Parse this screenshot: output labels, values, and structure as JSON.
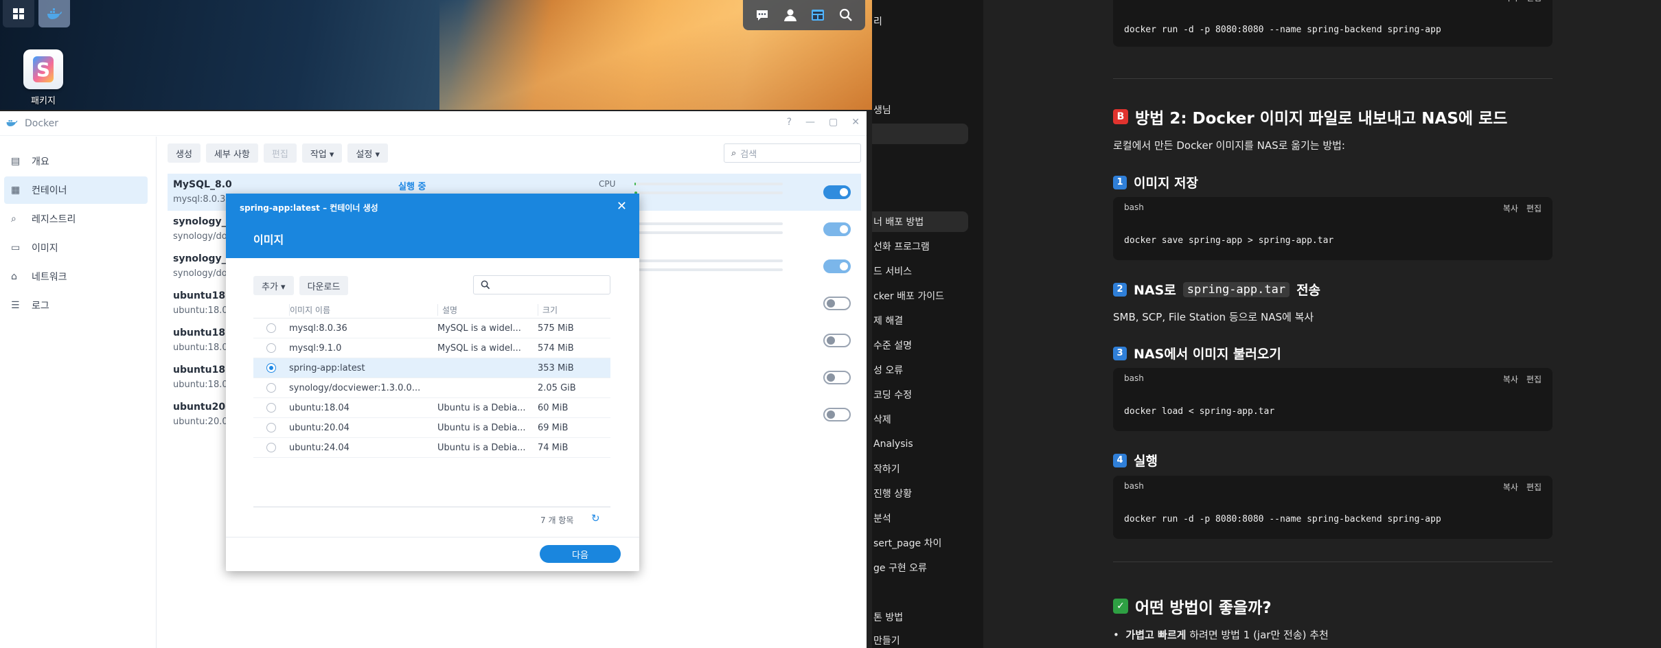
{
  "desktop": {
    "icon_label": "패키지"
  },
  "docker": {
    "title": "Docker",
    "sidebar": [
      {
        "label": "개요",
        "icon": "dashboard-icon"
      },
      {
        "label": "컨테이너",
        "icon": "container-icon"
      },
      {
        "label": "레지스트리",
        "icon": "registry-icon"
      },
      {
        "label": "이미지",
        "icon": "image-icon"
      },
      {
        "label": "네트워크",
        "icon": "network-icon"
      },
      {
        "label": "로그",
        "icon": "log-icon"
      }
    ],
    "toolbar": {
      "create": "생성",
      "details": "세부 사항",
      "edit": "편집",
      "action": "작업 ▾",
      "settings": "설정 ▾",
      "search_placeholder": "검색"
    },
    "containers": [
      {
        "name": "MySQL_8.0",
        "image": "mysql:8.0.3",
        "status": "실행 중",
        "cpu_label": "CPU",
        "cpu_usage": 0.02,
        "running": true
      },
      {
        "name": "synology_c",
        "image": "synology/doc",
        "running": true
      },
      {
        "name": "synology_",
        "image": "synology/doc",
        "running": true
      },
      {
        "name": "ubuntu18.",
        "image": "ubuntu:18.0",
        "running": false
      },
      {
        "name": "ubuntu18.",
        "image": "ubuntu:18.0",
        "running": false
      },
      {
        "name": "ubuntu18.",
        "image": "ubuntu:18.0",
        "running": false
      },
      {
        "name": "ubuntu20.",
        "image": "ubuntu:20.0",
        "running": false
      }
    ]
  },
  "modal": {
    "title": "spring-app:latest – 컨테이너 생성",
    "subtitle": "이미지",
    "add": "추가 ▾",
    "download": "다운로드",
    "columns": {
      "name": "이미지 이름",
      "desc": "설명",
      "size": "크기"
    },
    "rows": [
      {
        "name": "mysql:8.0.36",
        "desc": "MySQL is a widel...",
        "size": "575 MiB",
        "selected": false
      },
      {
        "name": "mysql:9.1.0",
        "desc": "MySQL is a widel...",
        "size": "574 MiB",
        "selected": false
      },
      {
        "name": "spring-app:latest",
        "desc": "",
        "size": "353 MiB",
        "selected": true
      },
      {
        "name": "synology/docviewer:1.3.0.0...",
        "desc": "",
        "size": "2.05 GiB",
        "selected": false
      },
      {
        "name": "ubuntu:18.04",
        "desc": "Ubuntu is a Debia...",
        "size": "60 MiB",
        "selected": false
      },
      {
        "name": "ubuntu:20.04",
        "desc": "Ubuntu is a Debia...",
        "size": "69 MiB",
        "selected": false
      },
      {
        "name": "ubuntu:24.04",
        "desc": "Ubuntu is a Debia...",
        "size": "74 MiB",
        "selected": false
      }
    ],
    "count": "7 개 항목",
    "next": "다음"
  },
  "mid_nav": [
    "리",
    "생님",
    "",
    "너 배포 방법",
    "선화 프로그램",
    "드 서비스",
    "cker 배포 가이드",
    "제 해결",
    "수준 설명",
    "성 오류",
    "코딩 수정",
    "삭제",
    "Analysis",
    "작하기",
    "진행 상황",
    "분석",
    "sert_page 차이",
    "ge 구현 오류",
    "",
    "톤 방법",
    "만들기"
  ],
  "article": {
    "code_lang": "bash",
    "copy": "복사",
    "edit": "편집",
    "top_code": "docker run -d -p 8080:8080 --name spring-backend spring-app",
    "method2_badge": "B",
    "method2_title": "방법 2: Docker 이미지 파일로 내보내고 NAS에 로드",
    "method2_intro": "로컬에서 만든 Docker 이미지를 NAS로 옮기는 방법:",
    "step1_num": "1",
    "step1_title": "이미지 저장",
    "step1_code": "docker save spring-app > spring-app.tar",
    "step2_num": "2",
    "step2_title_pre": "NAS로",
    "step2_code_inline": "spring-app.tar",
    "step2_title_post": "전송",
    "step2_text": "SMB, SCP, File Station 등으로 NAS에 복사",
    "step3_num": "3",
    "step3_title": "NAS에서 이미지 불러오기",
    "step3_code": "docker load < spring-app.tar",
    "step4_num": "4",
    "step4_title": "실행",
    "step4_code": "docker run -d -p 8080:8080 --name spring-backend spring-app",
    "which_badge": "✓",
    "which_title": "어떤 방법이 좋을까?",
    "bullet_bold": "가볍고 빠르게",
    "bullet_text": "하려면 방법 1 (jar만 전송) 추천"
  }
}
